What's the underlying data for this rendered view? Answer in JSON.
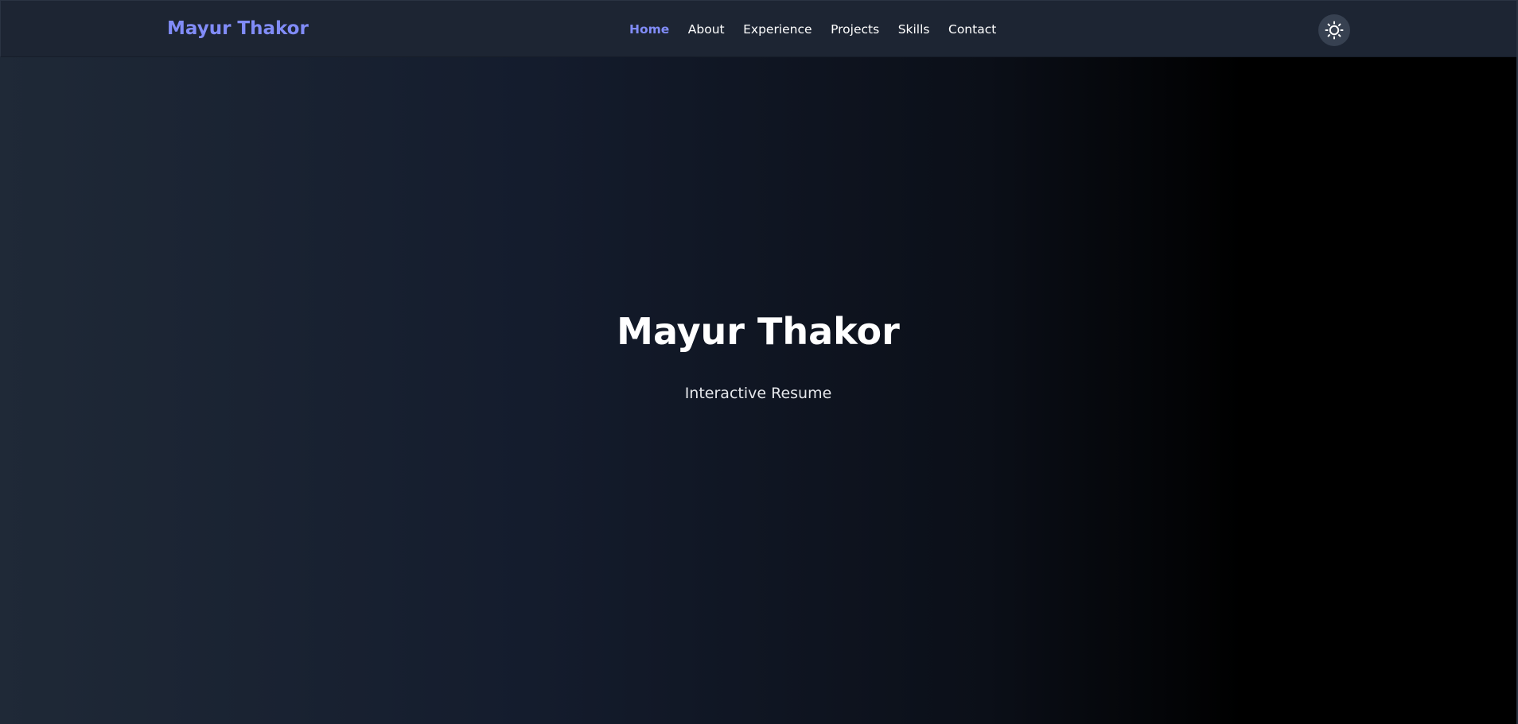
{
  "navbar": {
    "brand": "Mayur Thakor",
    "links": [
      {
        "label": "Home",
        "active": true
      },
      {
        "label": "About",
        "active": false
      },
      {
        "label": "Experience",
        "active": false
      },
      {
        "label": "Projects",
        "active": false
      },
      {
        "label": "Skills",
        "active": false
      },
      {
        "label": "Contact",
        "active": false
      }
    ],
    "theme_toggle_icon": "sun-icon"
  },
  "hero": {
    "title": "Mayur Thakor",
    "subtitle": "Interactive Resume"
  },
  "colors": {
    "accent": "#818cf8",
    "navbar_bg": "#1d2533",
    "toggle_bg": "#374151",
    "text": "#ffffff"
  }
}
